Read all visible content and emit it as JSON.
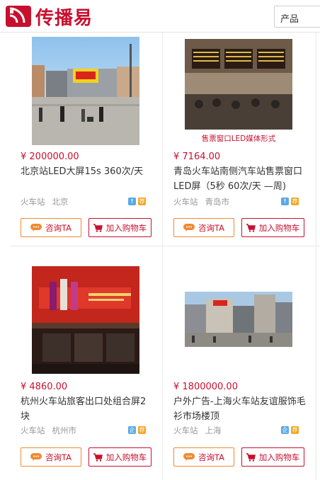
{
  "header": {
    "logo_text": "传播易",
    "search_value": "产品"
  },
  "products": [
    {
      "price": "¥ 200000.00",
      "title": "北京站LED大屏15s 360次/天",
      "category": "火车站",
      "city": "北京",
      "image_caption": "",
      "ask_label": "咨询TA",
      "cart_label": "加入购物车"
    },
    {
      "price": "¥ 7164.00",
      "title": "青岛火车站南侧汽车站售票窗口LED屏（5秒 60次/天 —周)",
      "category": "火车站",
      "city": "青岛市",
      "image_caption": "售票窗口LED媒体形式",
      "ask_label": "咨询TA",
      "cart_label": "加入购物车"
    },
    {
      "price": "¥ 4860.00",
      "title": "杭州火车站旅客出口处组合屏2块",
      "category": "火车站",
      "city": "杭州市",
      "image_caption": "",
      "ask_label": "咨询TA",
      "cart_label": "加入购物车"
    },
    {
      "price": "¥ 1800000.00",
      "title": "户外广告-上海火车站友谊服饰毛衫市场楼顶",
      "category": "火车站",
      "city": "上海",
      "image_caption": "",
      "ask_label": "咨询TA",
      "cart_label": "加入购物车"
    }
  ],
  "colors": {
    "brand": "#c8102e",
    "ask_border": "#ee8a33",
    "badge_blue": "#5aa9e6",
    "badge_orange": "#f5a623"
  }
}
